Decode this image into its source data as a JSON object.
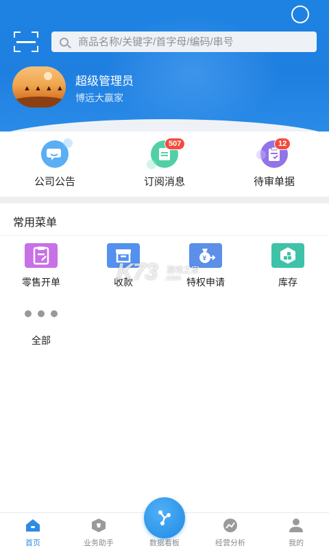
{
  "search": {
    "placeholder": "商品名称/关键字/首字母/编码/串号"
  },
  "user": {
    "name": "超级管理员",
    "company": "博远大赢家"
  },
  "quick": [
    {
      "label": "公司公告",
      "badge": ""
    },
    {
      "label": "订阅消息",
      "badge": "507"
    },
    {
      "label": "待审单据",
      "badge": "12"
    }
  ],
  "menu": {
    "title": "常用菜单",
    "items": [
      {
        "label": "零售开单"
      },
      {
        "label": "收款"
      },
      {
        "label": "特权申请"
      },
      {
        "label": "库存"
      },
      {
        "label": "全部"
      }
    ]
  },
  "watermark": {
    "brand": "K73",
    "sub1": "游戏之家",
    "sub2": ".com"
  },
  "tabs": [
    {
      "label": "首页"
    },
    {
      "label": "业务助手"
    },
    {
      "label": "数据看板"
    },
    {
      "label": "经营分析"
    },
    {
      "label": "我的"
    }
  ],
  "colors": {
    "primary": "#1f7fe0",
    "badge": "#f24c3d",
    "active_tab": "#2d8be6"
  }
}
